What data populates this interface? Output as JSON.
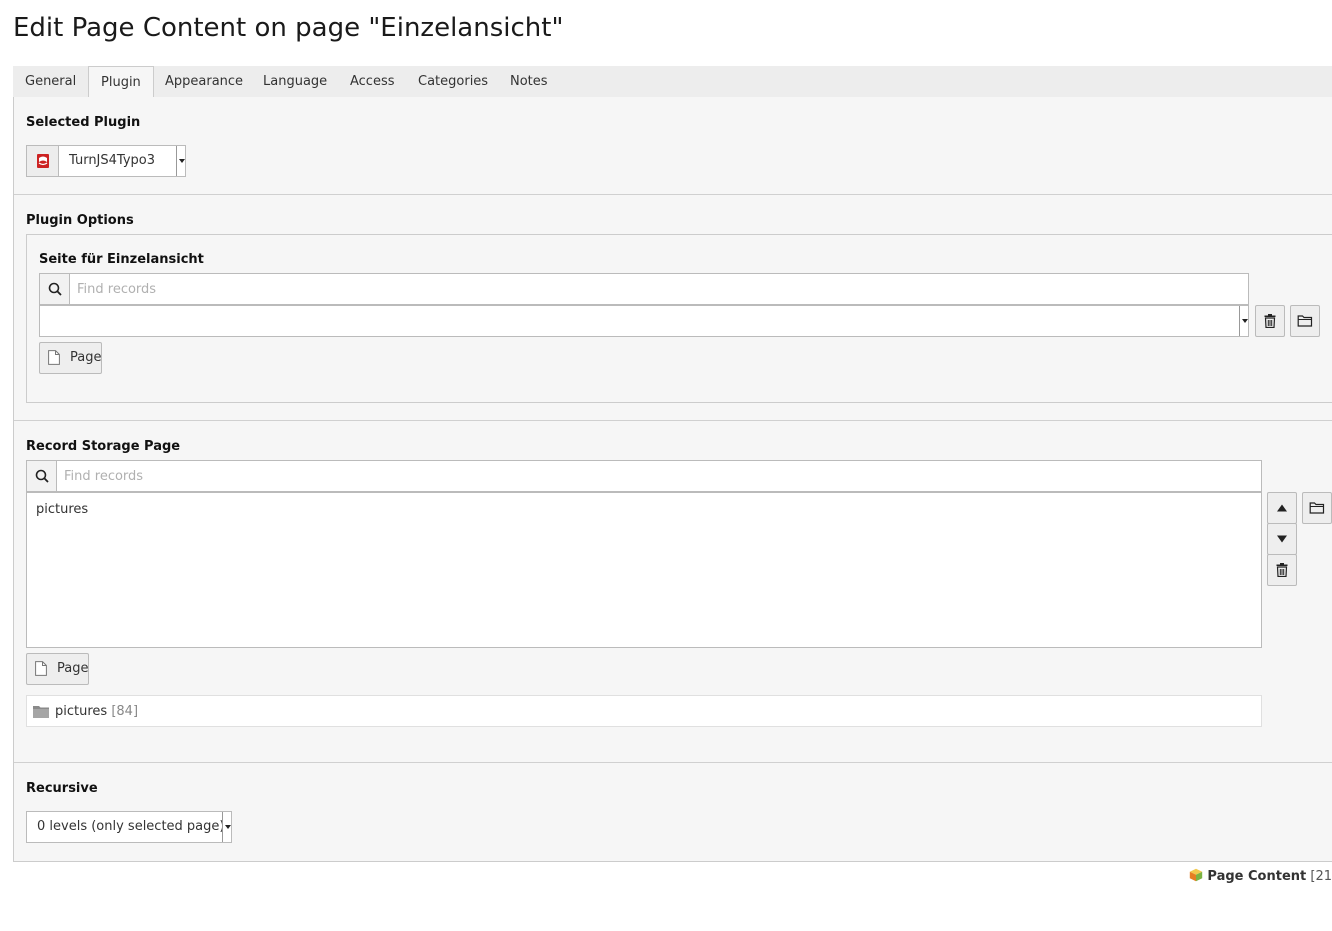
{
  "page": {
    "title": "Edit Page Content on page \"Einzelansicht\""
  },
  "tabs": [
    {
      "label": "General",
      "active": false
    },
    {
      "label": "Plugin",
      "active": true
    },
    {
      "label": "Appearance",
      "active": false
    },
    {
      "label": "Language",
      "active": false
    },
    {
      "label": "Access",
      "active": false
    },
    {
      "label": "Categories",
      "active": false
    },
    {
      "label": "Notes",
      "active": false
    }
  ],
  "selected_plugin": {
    "label": "Selected Plugin",
    "value": "TurnJS4Typo3",
    "icon": "plugin-icon"
  },
  "plugin_options": {
    "label": "Plugin Options",
    "single_view": {
      "label": "Seite für Einzelansicht",
      "search_placeholder": "Find records",
      "selected_value": "",
      "add_button": "Page"
    }
  },
  "record_storage": {
    "label": "Record Storage Page",
    "search_placeholder": "Find records",
    "items": [
      "pictures"
    ],
    "add_button": "Page",
    "info": {
      "name": "pictures",
      "uid": "[84]"
    }
  },
  "recursive": {
    "label": "Recursive",
    "value": "0 levels (only selected page)"
  },
  "footer": {
    "record_type": "Page Content",
    "record_uid": "[21"
  },
  "colors": {
    "panel_bg": "#f6f6f6",
    "tab_bar_bg": "#ededed",
    "border": "#cccccc",
    "plugin_icon_red": "#cc2222"
  }
}
